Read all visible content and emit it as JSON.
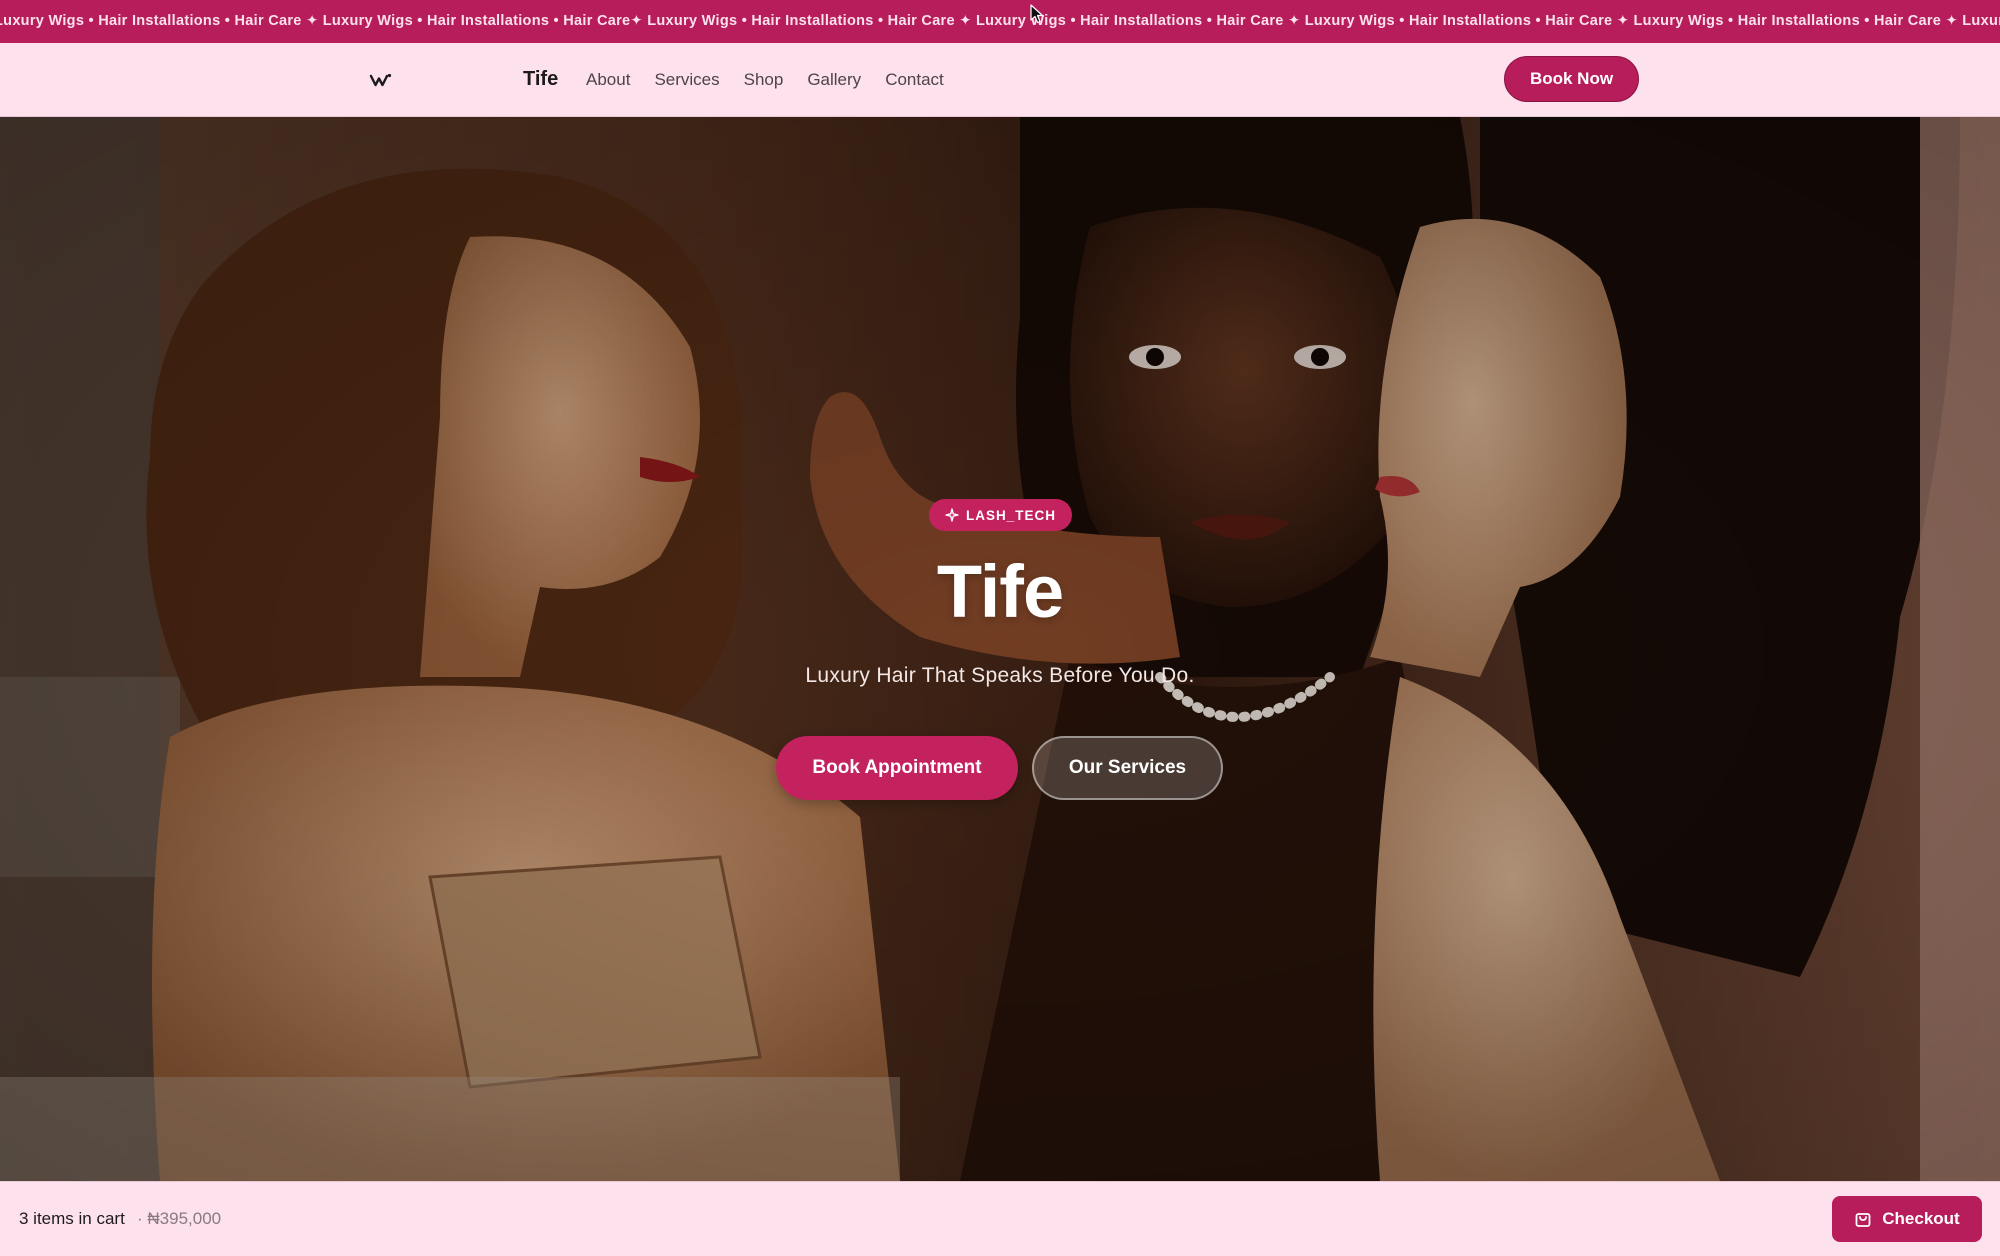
{
  "marquee": {
    "text": "Luxury Wigs • Hair Installations • Hair Care ✦ Luxury Wigs • Hair Installations • Hair Care✦ Luxury Wigs • Hair Installations • Hair Care ✦ Luxury Wigs • Hair Installations • Hair Care ✦ Luxury Wigs • Hair Installations • Hair Care ✦ Luxury Wigs • Hair Installations • Hair Care ✦ Luxury Wigs • Hair Installations • Hair Care ✦ Luxury Wigs • Hair Installations • Hair Care ✦ Luxury Wigs • Hair Installations • Hair Care ✦ Luxury Wigs • Hai"
  },
  "nav": {
    "logo_icon": "w-logo-icon",
    "brand": "Tife",
    "links": [
      "About",
      "Services",
      "Shop",
      "Gallery",
      "Contact"
    ],
    "cta": "Book Now"
  },
  "hero": {
    "badge": "LASH_TECH",
    "badge_icon": "sparkle-icon",
    "title": "Tife",
    "subtitle": "Luxury Hair That Speaks Before You Do.",
    "primary_button": "Book Appointment",
    "secondary_button": "Our Services"
  },
  "floating": {
    "whatsapp_icon": "whatsapp-icon"
  },
  "cart": {
    "count_label": "3 items in cart",
    "total_label": "· ₦395,000",
    "checkout_label": "Checkout",
    "checkout_icon": "shopping-bag-icon"
  },
  "colors": {
    "brand": "#b81d5b",
    "nav_bg": "#fde1ec",
    "whatsapp": "#25d366"
  }
}
